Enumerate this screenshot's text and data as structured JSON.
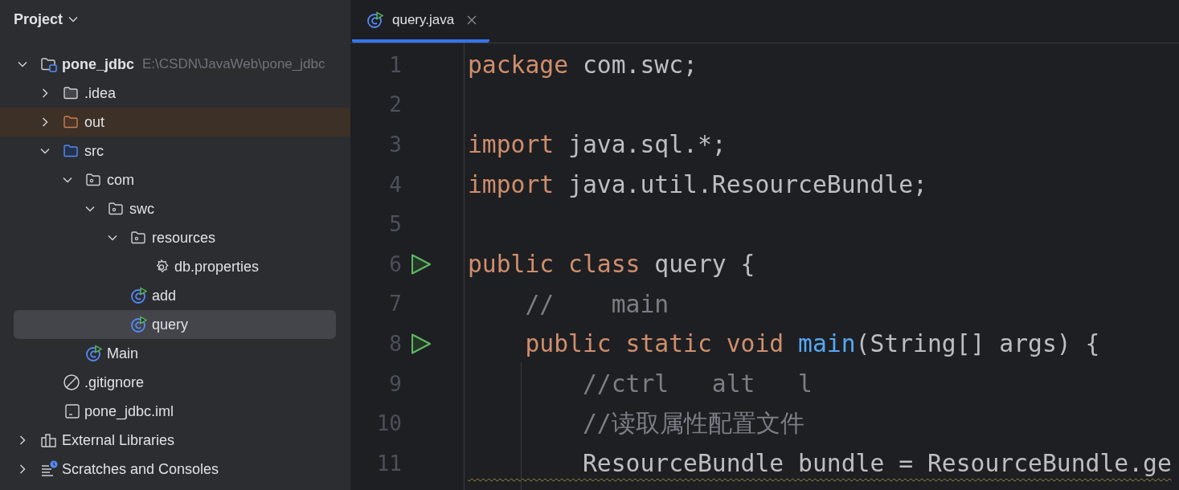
{
  "sidebar": {
    "title": "Project",
    "tree": [
      {
        "label": "pone_jdbc",
        "detail": "E:\\CSDN\\JavaWeb\\pone_jdbc",
        "kind": "project",
        "expanded": true,
        "selected": false,
        "children": [
          {
            "label": ".idea",
            "kind": "folder",
            "expanded": false,
            "selected": false
          },
          {
            "label": "out",
            "kind": "excluded-folder",
            "expanded": false,
            "selected": false
          },
          {
            "label": "src",
            "kind": "source-folder",
            "expanded": true,
            "selected": false,
            "children": [
              {
                "label": "com",
                "kind": "package",
                "expanded": true,
                "selected": false,
                "children": [
                  {
                    "label": "swc",
                    "kind": "package",
                    "expanded": true,
                    "selected": false,
                    "children": [
                      {
                        "label": "resources",
                        "kind": "package",
                        "expanded": true,
                        "selected": false,
                        "children": [
                          {
                            "label": "db.properties",
                            "kind": "properties",
                            "selected": false
                          }
                        ]
                      },
                      {
                        "label": "add",
                        "kind": "java-class",
                        "selected": false
                      },
                      {
                        "label": "query",
                        "kind": "java-class",
                        "selected": true
                      }
                    ]
                  }
                ]
              },
              {
                "label": "Main",
                "kind": "java-class",
                "selected": false
              }
            ]
          },
          {
            "label": ".gitignore",
            "kind": "gitignore",
            "selected": false
          },
          {
            "label": "pone_jdbc.iml",
            "kind": "iml",
            "selected": false
          }
        ]
      },
      {
        "label": "External Libraries",
        "kind": "libraries",
        "expanded": false,
        "selected": false
      },
      {
        "label": "Scratches and Consoles",
        "kind": "scratches",
        "expanded": false,
        "selected": false
      }
    ]
  },
  "editor": {
    "tabs": [
      {
        "label": "query.java",
        "selected": true
      }
    ],
    "lines": [
      {
        "number": "1",
        "tokens": [
          {
            "kind": "keyword",
            "text": "package"
          },
          {
            "kind": "plain",
            "text": " com.swc;"
          }
        ]
      },
      {
        "number": "2"
      },
      {
        "number": "3",
        "tokens": [
          {
            "kind": "keyword",
            "text": "import"
          },
          {
            "kind": "plain",
            "text": " java.sql.*;"
          }
        ]
      },
      {
        "number": "4",
        "tokens": [
          {
            "kind": "keyword",
            "text": "import"
          },
          {
            "kind": "plain",
            "text": " java.util.ResourceBundle;"
          }
        ]
      },
      {
        "number": "5"
      },
      {
        "number": "6",
        "runnable": true,
        "tokens": [
          {
            "kind": "keyword",
            "text": "public class"
          },
          {
            "kind": "plain",
            "text": " query {"
          }
        ]
      },
      {
        "number": "7",
        "tokens": [
          {
            "kind": "comment",
            "text": "    //    main"
          }
        ]
      },
      {
        "number": "8",
        "runnable": true,
        "tokens": [
          {
            "kind": "keyword",
            "text": "    public static void "
          },
          {
            "kind": "method",
            "text": "main"
          },
          {
            "kind": "plain",
            "text": "(String[] args) {"
          }
        ]
      },
      {
        "number": "9",
        "tokens": [
          {
            "kind": "comment",
            "text": "        //ctrl   alt   l"
          }
        ]
      },
      {
        "number": "10",
        "tokens": [
          {
            "kind": "comment",
            "text": "        //读取属性配置文件"
          }
        ]
      },
      {
        "number": "11",
        "warning": true,
        "tokens": [
          {
            "kind": "plain",
            "text": "        ResourceBundle bundle = ResourceBundle.ge"
          }
        ]
      }
    ]
  }
}
